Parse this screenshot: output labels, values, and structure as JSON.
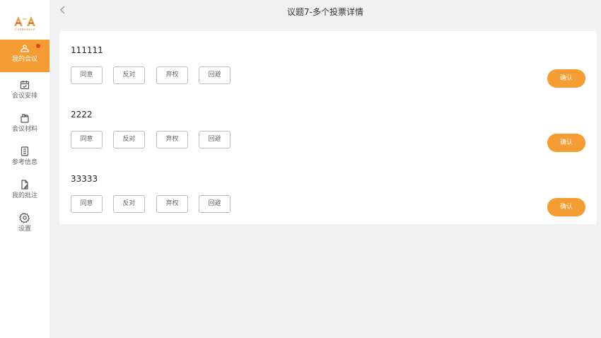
{
  "logo_text": "Conference",
  "sidebar": {
    "items": [
      {
        "label": "我的会议",
        "icon": "meeting-icon"
      },
      {
        "label": "会议安排",
        "icon": "calendar-icon"
      },
      {
        "label": "会议材料",
        "icon": "material-icon"
      },
      {
        "label": "参考信息",
        "icon": "info-doc-icon"
      },
      {
        "label": "我的批注",
        "icon": "annotation-icon"
      },
      {
        "label": "设置",
        "icon": "settings-icon"
      }
    ],
    "active_index": 0,
    "notification_dot": true
  },
  "header": {
    "title": "议题7-多个投票详情"
  },
  "vote_options": [
    "同意",
    "反对",
    "弃权",
    "回避"
  ],
  "confirm_label": "确认",
  "topics": [
    {
      "name": "111111"
    },
    {
      "name": "2222"
    },
    {
      "name": "33333"
    }
  ],
  "colors": {
    "accent": "#f59c33",
    "notification": "#e53b2e",
    "background": "#f1f1f2"
  }
}
